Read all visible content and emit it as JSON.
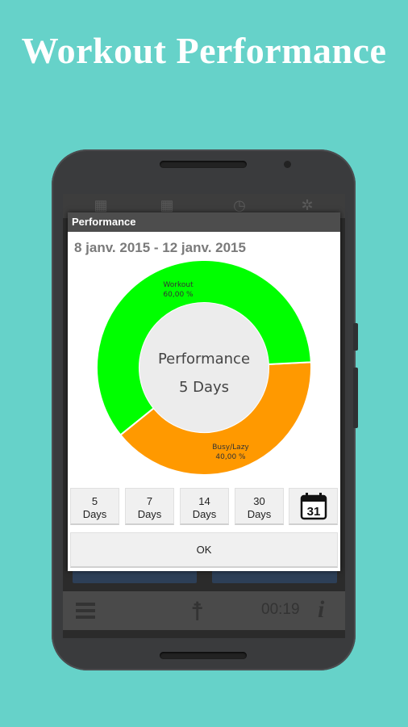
{
  "headline": "Workout Performance",
  "background_app": {
    "bottom_bar": {
      "timer": "00:19"
    }
  },
  "dialog": {
    "title": "Performance",
    "date_range": "8 janv. 2015 - 12 janv. 2015",
    "range_buttons": [
      {
        "line1": "5",
        "line2": "Days"
      },
      {
        "line1": "7",
        "line2": "Days"
      },
      {
        "line1": "14",
        "line2": "Days"
      },
      {
        "line1": "30",
        "line2": "Days"
      }
    ],
    "calendar_day": "31",
    "ok_label": "OK"
  },
  "chart_data": {
    "type": "pie",
    "center_label_line1": "Performance",
    "center_label_line2": "5 Days",
    "slices": [
      {
        "label": "Workout",
        "value_label": "60,00 %",
        "value": 60.0,
        "color": "#00ff00"
      },
      {
        "label": "Busy/Lazy",
        "value_label": "40,00 %",
        "value": 40.0,
        "color": "#ff9900"
      }
    ]
  },
  "colors": {
    "background": "#66d2c9",
    "workout": "#00ff00",
    "busy": "#ff9900",
    "center": "#eeeeee"
  }
}
